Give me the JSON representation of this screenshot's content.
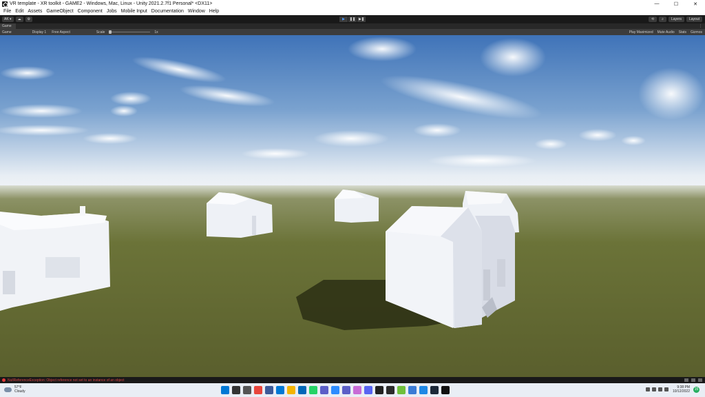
{
  "window": {
    "title": "VR template - XR toolkit - GAME2 - Windows, Mac, Linux - Unity 2021.2.7f1 Personal* <DX11>",
    "minimize": "—",
    "maximize": "☐",
    "close": "✕"
  },
  "menu": [
    "File",
    "Edit",
    "Assets",
    "GameObject",
    "Component",
    "Jobs",
    "Mobile Input",
    "Documentation",
    "Window",
    "Help"
  ],
  "toolbar": {
    "account": "AK ▾",
    "cloud": "☁",
    "collab": "⚙",
    "play": "▶",
    "pause": "❚❚",
    "step": "▶❚",
    "history": "⟲",
    "search": "⌕",
    "layers": "Layers",
    "layout": "Layout"
  },
  "game_tab": {
    "label": "Game",
    "more": "⋮"
  },
  "game_controls": {
    "mode": "Game",
    "display": "Display 1",
    "aspect": "Free Aspect",
    "scale_label": "Scale",
    "scale_value": "1x",
    "play_maximized": "Play Maximized",
    "mute_audio": "Mute Audio",
    "stats": "Stats",
    "gizmos": "Gizmos"
  },
  "console": {
    "message": "NullReferenceException: Object reference not set to an instance of an object"
  },
  "taskbar": {
    "temperature": "57°F",
    "condition": "Cloudy",
    "time": "9:38 PM",
    "date": "10/12/2022",
    "notification_count": "15",
    "app_icons": [
      "windows-start",
      "search",
      "task-view",
      "chrome",
      "explorer",
      "mail",
      "file-explorer",
      "store",
      "whatsapp",
      "chat",
      "zoom",
      "teams",
      "photos",
      "discord",
      "unity-hub",
      "terminal",
      "green-app",
      "notepad",
      "blue-app",
      "steam",
      "unity"
    ],
    "app_colors": [
      "#0078d4",
      "#333333",
      "#555555",
      "#e8453c",
      "#3c5a99",
      "#0078d4",
      "#f4b400",
      "#0067b8",
      "#25d366",
      "#5b5fc7",
      "#2d8cff",
      "#5b5fc7",
      "#c86bd6",
      "#5865f2",
      "#222222",
      "#2b2b2b",
      "#6fbf3b",
      "#3a7bd5",
      "#1e88e5",
      "#1b2838",
      "#111111"
    ]
  },
  "colors": {
    "editor_dark": "#191919",
    "panel": "#3c3c3c",
    "accent_play": "#4c9bff",
    "error": "#d94545",
    "sky_top": "#3f73b8",
    "horizon": "#f2f4f6",
    "ground": "#5f6a33"
  }
}
